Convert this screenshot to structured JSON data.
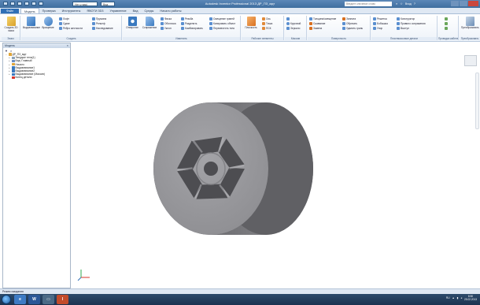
{
  "window": {
    "title": "Autodesk Inventor Professional 2013  ДР_ПЗ_мдт",
    "combo_material": "Нет у вас(",
    "combo_view": "Вид",
    "search_placeholder": "Введите ключевое слово",
    "user": "Вход"
  },
  "tabs": {
    "file": "Файл",
    "items": [
      "Модель",
      "Проверка",
      "Инструменты",
      "ЯВОТИ 3D3",
      "Управление",
      "Вид",
      "Среды",
      "Начало работы"
    ]
  },
  "ribbon": {
    "groups": [
      {
        "label": "Эскиз",
        "buttons": [
          "Создать 2D эскиз"
        ]
      },
      {
        "label": "Создать",
        "big": [
          "Выдавливание",
          "Вращение"
        ],
        "small": [
          "Лофт",
          "Сдвиг",
          "Ребро жесткости",
          "Пружина",
          "Рельеф",
          "Наследование"
        ]
      },
      {
        "label": "Изменить",
        "big": [
          "Отверстие",
          "Сопряжение"
        ],
        "small": [
          "Фаска",
          "Оболочка",
          "Уклон",
          "Резьба",
          "Разделить",
          "Комбинировать",
          "Смещение граней",
          "Копировать объект",
          "Переместить тело"
        ]
      },
      {
        "label": "Рабочие элементы",
        "big": [
          "Плоскость"
        ],
        "small": [
          "Ось",
          "Точка",
          "ПСК"
        ]
      },
      {
        "label": "Массив",
        "small": [
          "Круговой",
          "Зеркало"
        ]
      },
      {
        "label": "Поверхность",
        "small": [
          "Толщина/смещение",
          "Сшивание",
          "Замена",
          "Заплата",
          "Обрезать",
          "Удалить грань"
        ]
      },
      {
        "label": "Пластмассовые детали",
        "small": [
          "Решетка",
          "Бобышка",
          "Упор",
          "Конструктор",
          "Правило сопряжения",
          "Выступ"
        ]
      },
      {
        "label": "Проводка кабелей",
        "small": []
      },
      {
        "label": "Преобразовать",
        "small": [
          "Преобразовать",
          "листовой мет"
        ]
      }
    ]
  },
  "browser": {
    "title": "Модель",
    "nodes": [
      {
        "label": "ДР_ПЗ_мдт",
        "indent": 0
      },
      {
        "label": "Твердые тела(1)",
        "indent": 1
      },
      {
        "label": "Вид: Главный",
        "indent": 1
      },
      {
        "label": "Начало",
        "indent": 1
      },
      {
        "label": "Выдавливание1",
        "indent": 1
      },
      {
        "label": "Выдавливание2",
        "indent": 1
      },
      {
        "label": "Выдавливание (Массив)",
        "indent": 1
      },
      {
        "label": "Конец детали",
        "indent": 1
      }
    ]
  },
  "status": {
    "text": "Режим ожидания"
  },
  "taskbar": {
    "lang": "RU",
    "time": "8:50",
    "date": "25.02.2013"
  },
  "colors": {
    "model_face": "#9a9a9e",
    "model_side": "#7a7a7e",
    "accent": "#2f6fb6"
  }
}
